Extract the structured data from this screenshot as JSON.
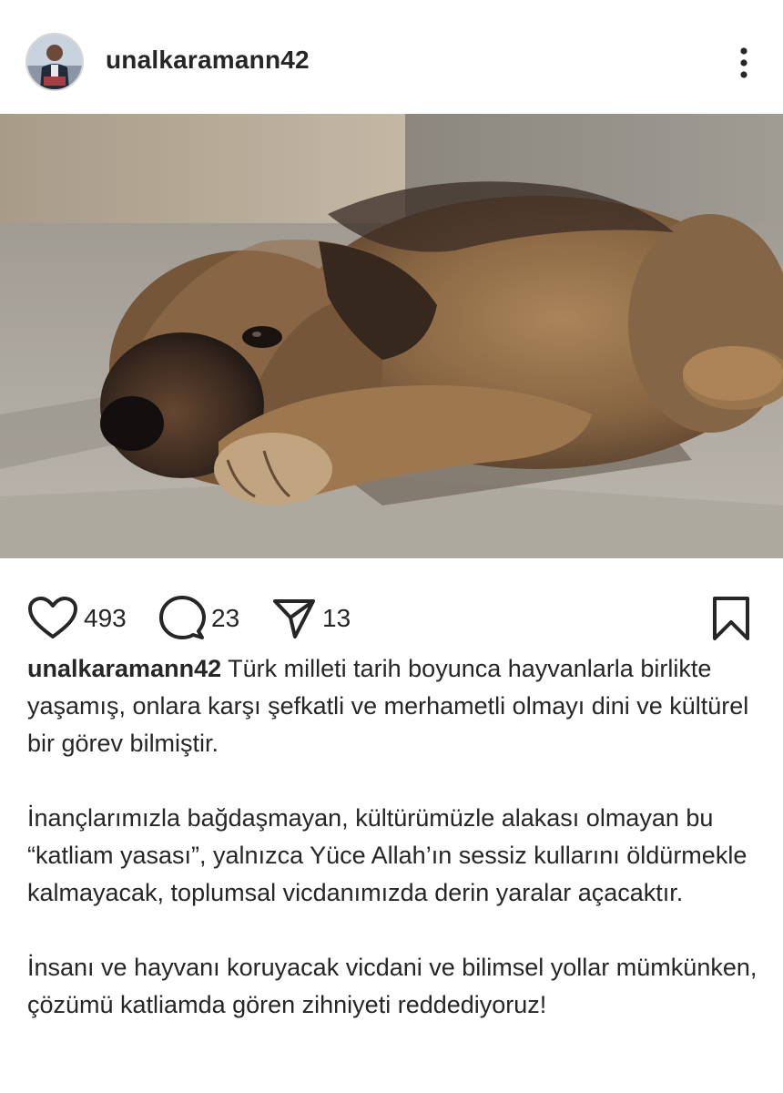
{
  "post": {
    "username": "unalkaramann42",
    "avatar_icon": "profile-photo",
    "more_icon": "more-vertical-icon",
    "image_description_icon": "puppy-photo"
  },
  "actions": {
    "likes": "493",
    "comments": "23",
    "shares": "13",
    "like_icon": "heart-icon",
    "comment_icon": "comment-bubble-icon",
    "share_icon": "send-icon",
    "save_icon": "bookmark-icon"
  },
  "caption": {
    "username": "unalkaramann42",
    "paragraph_1": "Türk milleti tarih boyunca hayvanlarla birlikte yaşamış, onlara karşı şefkatli ve merhametli olmayı dini ve kültürel bir görev bilmiştir.",
    "paragraph_2": "İnançlarımızla bağdaşmayan, kültürümüzle alakası olmayan bu “katliam yasası”, yalnızca Yüce Allah’ın sessiz kullarını öldürmekle kalmayacak, toplumsal vicdanımızda derin yaralar açacaktır.",
    "paragraph_3": "İnsanı ve hayvanı koruyacak vicdani ve bilimsel yollar mümkünken, çözümü katliamda gören zihniyeti reddediyoruz!"
  },
  "colors": {
    "text": "#262626",
    "background": "#ffffff"
  }
}
